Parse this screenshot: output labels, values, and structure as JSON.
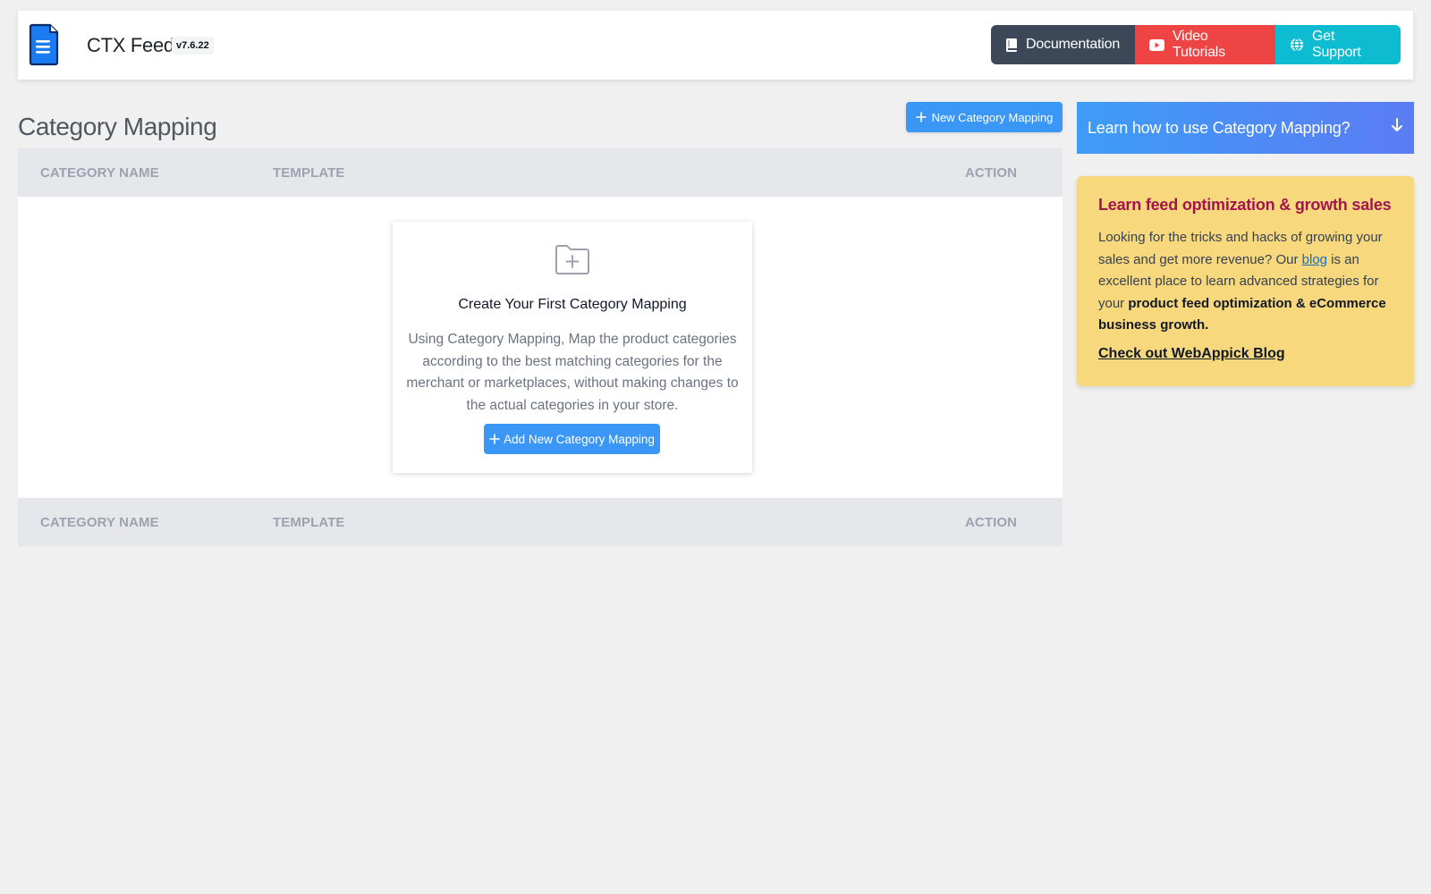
{
  "header": {
    "title": "CTX Feed",
    "version": "v7.6.22",
    "buttons": {
      "documentation": "Documentation",
      "video_tutorials": "Video Tutorials",
      "get_support": "Get Support"
    }
  },
  "page": {
    "title": "Category Mapping",
    "new_button": "New Category Mapping"
  },
  "table": {
    "columns": [
      "CATEGORY NAME",
      "TEMPLATE",
      "ACTION"
    ]
  },
  "empty_state": {
    "icon": "folder-plus-icon",
    "title": "Create Your First Category Mapping",
    "description": "Using Category Mapping, Map the product categories according to the best matching categories for the merchant or marketplaces, without making changes to the actual categories in your store.",
    "button": "Add New Category Mapping"
  },
  "sidebar": {
    "learn_banner": "Learn how to use Category Mapping?",
    "promo": {
      "title": "Learn feed optimization & growth sales",
      "text_before_link": "Looking for the tricks and hacks of growing your sales and get more revenue? Our ",
      "link_text": "blog",
      "text_after_link": " is an excellent place to learn advanced strategies for your ",
      "text_bold": "product feed optimization & eCommerce business growth.",
      "cta": "Check out WebAppick Blog"
    }
  },
  "colors": {
    "primary_blue": "#3b97f6",
    "docs_button": "#3c4858",
    "video_button": "#ef4444",
    "support_button": "#0ebcd2",
    "promo_background": "#f7d87d",
    "promo_title": "#a3154f"
  }
}
